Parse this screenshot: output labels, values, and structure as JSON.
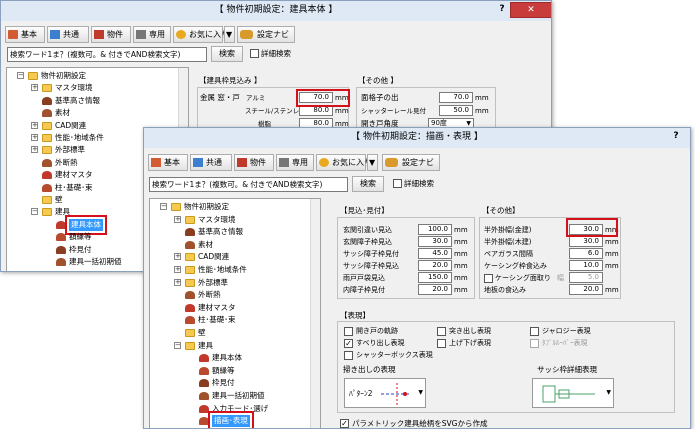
{
  "back_window": {
    "title": "【 物件初期設定：建具本体 】",
    "help_label": "?",
    "close_label": "✕",
    "toolbar": {
      "basic": "基本",
      "common": "共通",
      "property": "物件",
      "exclusive": "専用",
      "favorites": "お気に入り",
      "dropdown": "▼",
      "navi": "設定ナビ"
    },
    "search": {
      "placeholder": "検索ワード1ま？(複数可。& 付きでAND検索文字)",
      "button": "検索",
      "detail": "詳細検索"
    },
    "tree": [
      {
        "label": "物件初期設定",
        "expander": "−"
      },
      {
        "label": "マスタ環境",
        "expander": "+"
      },
      {
        "label": "基準高さ情報"
      },
      {
        "label": "素材"
      },
      {
        "label": "CAD関連",
        "expander": "+"
      },
      {
        "label": "性能･地域条件",
        "expander": "+"
      },
      {
        "label": "外部標準",
        "expander": "+"
      },
      {
        "label": "外断熱"
      },
      {
        "label": "建材マスタ"
      },
      {
        "label": "柱･基礎･束"
      },
      {
        "label": "壁"
      },
      {
        "label": "建具",
        "expander": "−"
      },
      {
        "label": "建具本体",
        "selected": true
      },
      {
        "label": "額縁等"
      },
      {
        "label": "枠見付"
      },
      {
        "label": "建具一括初期値"
      }
    ],
    "section_left": {
      "title": "【建具枠見込み 】",
      "rows": [
        {
          "label": "金属 窓・戸",
          "sub": "アルミ",
          "value": "70.0",
          "unit": "mm"
        },
        {
          "label": "",
          "sub": "スチール/ステンレス",
          "value": "80.0",
          "unit": "mm"
        },
        {
          "label": "",
          "sub": "樹脂",
          "value": "80.0",
          "unit": "mm"
        }
      ]
    },
    "section_right": {
      "title": "【その他 】",
      "rows": [
        {
          "label": "面格子の出",
          "value": "70.0",
          "unit": "mm"
        },
        {
          "label": "シャッターレール見付",
          "value": "50.0",
          "unit": "mm"
        },
        {
          "label": "開き戸角度",
          "value": "90度",
          "unit": ""
        }
      ]
    }
  },
  "front_window": {
    "title": "【 物件初期設定：描画・表現 】",
    "help_label": "?",
    "toolbar": {
      "basic": "基本",
      "common": "共通",
      "property": "物件",
      "exclusive": "専用",
      "favorites": "お気に入り",
      "dropdown": "▼",
      "navi": "設定ナビ"
    },
    "search": {
      "placeholder": "検索ワード1ま？(複数可。& 付きでAND検索文字)",
      "button": "検索",
      "detail": "詳細検索"
    },
    "tree": [
      {
        "label": "物件初期設定",
        "expander": "−"
      },
      {
        "label": "マスタ環境",
        "expander": "+"
      },
      {
        "label": "基準高さ情報"
      },
      {
        "label": "素材"
      },
      {
        "label": "CAD関連",
        "expander": "+"
      },
      {
        "label": "性能･地域条件",
        "expander": "+"
      },
      {
        "label": "外部標準",
        "expander": "+"
      },
      {
        "label": "外断熱"
      },
      {
        "label": "建材マスタ"
      },
      {
        "label": "柱･基礎･束"
      },
      {
        "label": "壁"
      },
      {
        "label": "建具",
        "expander": "−"
      },
      {
        "label": "建具本体"
      },
      {
        "label": "額縁等"
      },
      {
        "label": "枠見付"
      },
      {
        "label": "建具一括初期値"
      },
      {
        "label": "入力モード･選げ"
      },
      {
        "label": "描画･表現",
        "selected": true
      }
    ],
    "mitsuke": {
      "title": "【見込･見付】",
      "rows": [
        {
          "label": "玄関引違い見込",
          "value": "100.0",
          "unit": "mm"
        },
        {
          "label": "玄関障子枠見込",
          "value": "30.0",
          "unit": "mm"
        },
        {
          "label": "サッシ障子枠見付",
          "value": "45.0",
          "unit": "mm"
        },
        {
          "label": "サッシ障子枠見込",
          "value": "20.0",
          "unit": "mm"
        },
        {
          "label": "雨戸戸袋見込",
          "value": "150.0",
          "unit": "mm"
        },
        {
          "label": "内障子枠見付",
          "value": "20.0",
          "unit": "mm"
        }
      ]
    },
    "other": {
      "title": "【その他】",
      "rows": [
        {
          "label": "半外掛幅(金建)",
          "value": "30.0",
          "unit": "mm"
        },
        {
          "label": "半外掛幅(木建)",
          "value": "30.0",
          "unit": "mm"
        },
        {
          "label": "ペアガラス間隔",
          "value": "6.0",
          "unit": "mm"
        },
        {
          "label": "ケーシング枠食込み",
          "value": "10.0",
          "unit": "mm"
        },
        {
          "label": "ケーシング面取り",
          "value": "5.0",
          "unit": "幅",
          "checkbox": true
        },
        {
          "label": "地板の食込み",
          "value": "20.0",
          "unit": "mm"
        }
      ]
    },
    "expression": {
      "title": "【表現】",
      "checks": [
        {
          "label": "開き戸の軌跡",
          "checked": false
        },
        {
          "label": "突き出し表現",
          "checked": false
        },
        {
          "label": "ジャロジー表現",
          "checked": false
        },
        {
          "label": "すべり出し表現",
          "checked": true
        },
        {
          "label": "上げ下げ表現",
          "checked": false
        },
        {
          "label": "ﾀﾌﾞﾙﾙｰﾊﾞｰ表現",
          "checked": false,
          "disabled": true
        },
        {
          "label": "シャッターボックス表現",
          "checked": false
        }
      ],
      "pushout_label": "掃き出しの表現",
      "pushout_value": "ﾊﾟﾀｰﾝ2",
      "sash_label": "サッシ枠詳細表現"
    },
    "svg_option": "パラメトリック建具絵柄をSVGから作成",
    "colors": {
      "highlight": "#d4101a",
      "selection": "#3399ff"
    }
  }
}
